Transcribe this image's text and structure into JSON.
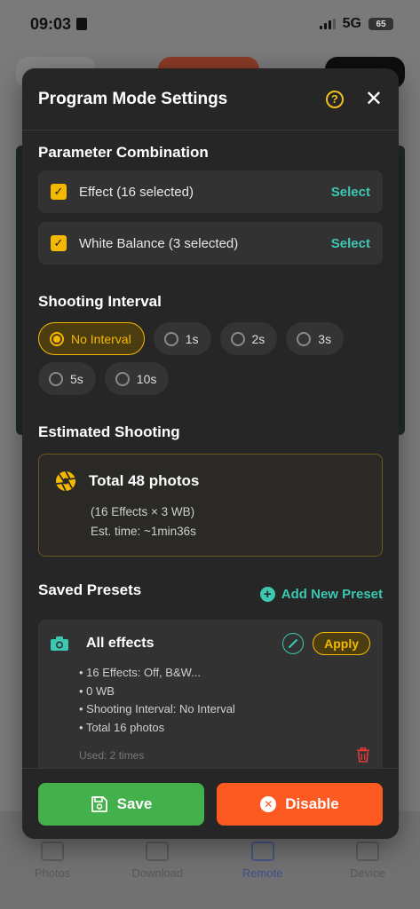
{
  "status": {
    "time": "09:03",
    "network": "5G",
    "battery": "65"
  },
  "background_tabs": [
    {
      "label": "Photos",
      "icon": "photos-icon"
    },
    {
      "label": "Download",
      "icon": "download-icon"
    },
    {
      "label": "Remote",
      "icon": "remote-icon"
    },
    {
      "label": "Device",
      "icon": "wifi-icon"
    }
  ],
  "modal": {
    "title": "Program Mode Settings",
    "parameter_combination": {
      "title": "Parameter Combination",
      "items": [
        {
          "label": "Effect (16 selected)",
          "action": "Select",
          "checked": true
        },
        {
          "label": "White Balance (3 selected)",
          "action": "Select",
          "checked": true
        }
      ]
    },
    "shooting_interval": {
      "title": "Shooting Interval",
      "options": [
        "No Interval",
        "1s",
        "2s",
        "3s",
        "5s",
        "10s"
      ],
      "selected": "No Interval"
    },
    "estimated_shooting": {
      "title": "Estimated Shooting",
      "total": "Total 48 photos",
      "detail": "(16 Effects × 3 WB)",
      "time": "Est. time: ~1min36s"
    },
    "saved_presets": {
      "title": "Saved Presets",
      "add_label": "Add New Preset",
      "items": [
        {
          "name": "All effects",
          "apply_label": "Apply",
          "lines": [
            "• 16 Effects: Off, B&W...",
            "• 0 WB",
            "• Shooting Interval: No Interval",
            "• Total 16 photos"
          ],
          "used": "Used: 2 times"
        }
      ]
    },
    "footer": {
      "save_label": "Save",
      "disable_label": "Disable"
    }
  },
  "colors": {
    "accent_yellow": "#f5b800",
    "teal": "#3cc8b3",
    "save_green": "#43b04b",
    "disable_orange": "#fd5a22",
    "trash_red": "#e53935"
  }
}
